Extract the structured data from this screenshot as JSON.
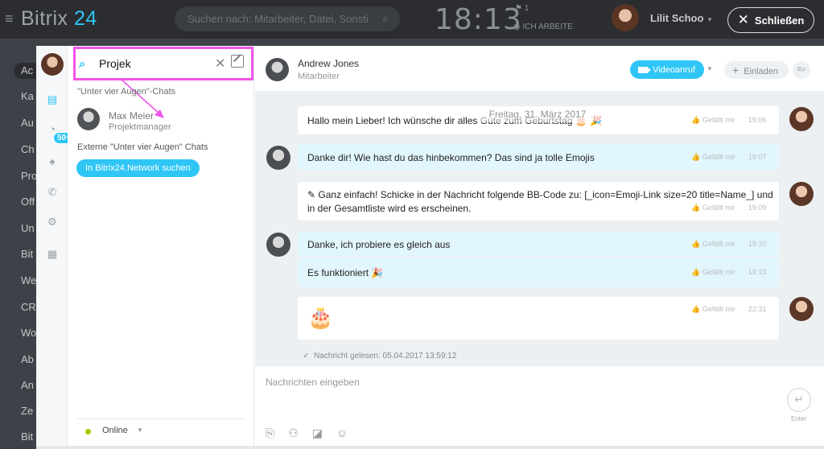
{
  "topbar": {
    "brand_prefix": "Bitrix",
    "brand_suffix": "24",
    "search_placeholder": "Suchen nach: Mitarbeiter, Datei, Sonsti",
    "time": "18:13",
    "flag_count": "1",
    "work_status": "ICH ARBEITE",
    "user_name": "Lilit Schoo",
    "close_label": "Schließen"
  },
  "bg_menu": {
    "items": [
      "Ac",
      "Ka",
      "Au",
      "Ch",
      "Pro",
      "Off",
      "Un",
      "Bit",
      "We",
      "CR",
      "Wo",
      "Ab",
      "An",
      "Ze",
      "Bit"
    ]
  },
  "rail": {
    "badge": "50+",
    "icons": [
      "chat-icon",
      "notifications-icon",
      "bell-icon",
      "phone-icon",
      "settings-icon",
      "list-icon"
    ]
  },
  "search_panel": {
    "query": "Projek",
    "section_private": "\"Unter vier Augen\"-Chats",
    "contact_name": "Max Meier",
    "contact_position": "Projektmanager",
    "section_external": "Externe \"Unter vier Augen\" Chats",
    "network_button": "In Bitrix24.Network suchen",
    "status": "Online"
  },
  "chat": {
    "name": "Andrew Jones",
    "role": "Mitarbeiter",
    "video_label": "Videoanruf",
    "invite_label": "Einladen",
    "date": "Freitag, 31. März 2017",
    "like_label": "Gefällt mir",
    "messages": [
      {
        "text": "Hallo mein Lieber! Ich wünsche dir alles Gute zum Geburtstag 🎂 🎉",
        "time": "19:06"
      },
      {
        "text": "Danke dir! Wie hast du das hinbekommen? Das sind ja tolle Emojis",
        "time": "19:07"
      },
      {
        "text1": "✎ Ganz einfach! Schicke in der Nachricht folgende BB-Code zu: [_icon=Emoji-Link size=20 title=Name_] und",
        "text2": "in der Gesamtliste wird es erscheinen.",
        "time": "19:09"
      },
      {
        "text": "Danke, ich probiere es gleich aus",
        "time": "19:10"
      },
      {
        "text": "Es funktioniert 🎉",
        "time": "19:13"
      },
      {
        "text": "🎂",
        "time": "22:31"
      }
    ],
    "read_receipt": "Nachricht gelesen: 05.04.2017 13:59:12",
    "composer_placeholder": "Nachrichten eingeben",
    "send_label": "Enter"
  },
  "colors": {
    "accent": "#2fc6f6",
    "highlight": "#f055e8",
    "online": "#9dcf00",
    "bubble_out": "#e2f6fd"
  }
}
